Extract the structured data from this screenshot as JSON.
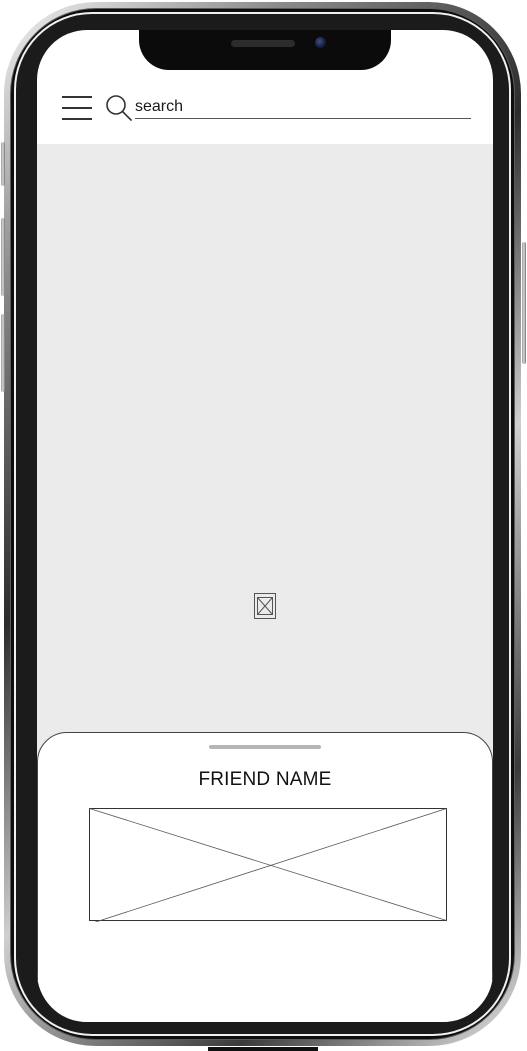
{
  "search": {
    "value": "search"
  },
  "bottom_sheet": {
    "title": "FRIEND NAME"
  },
  "icons": {
    "menu": "hamburger-menu-icon",
    "search": "search-icon",
    "map_placeholder": "image-placeholder-icon",
    "photo_placeholder": "image-placeholder"
  },
  "colors": {
    "content_background": "#ebebeb",
    "sheet_background": "#ffffff",
    "handle": "#b5b5b5"
  }
}
